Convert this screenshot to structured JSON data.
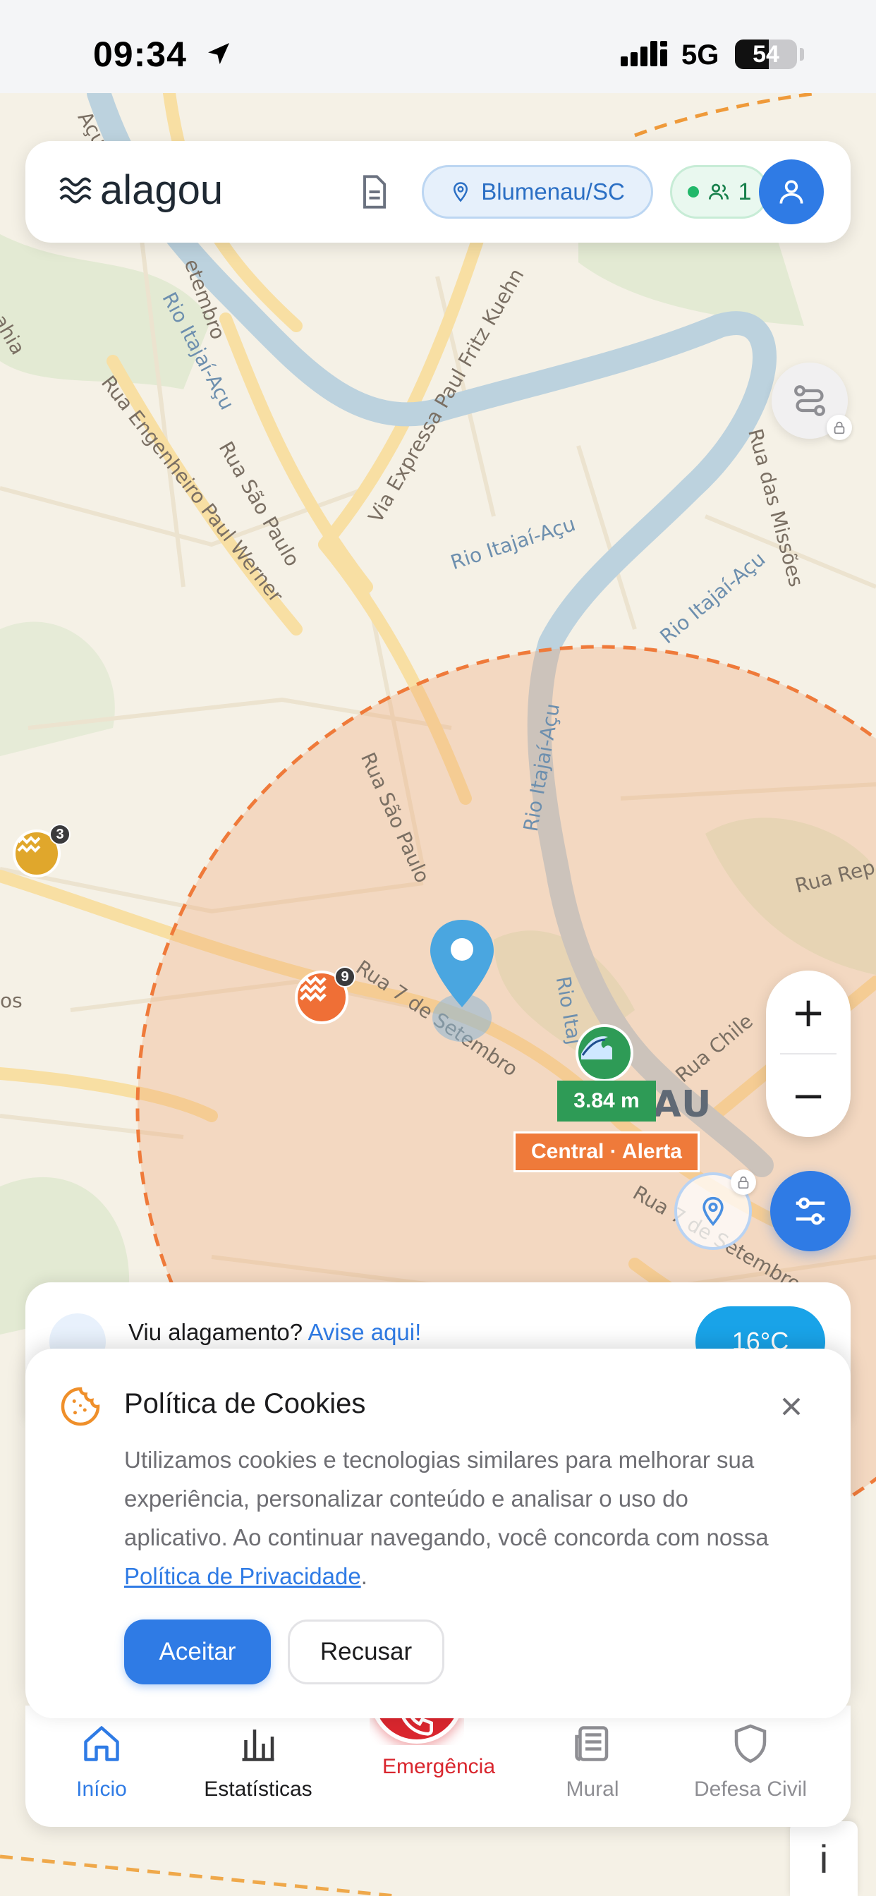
{
  "status_bar": {
    "time": "09:34",
    "network": "5G",
    "battery": "54",
    "battery_level": 0.54
  },
  "header": {
    "logo_text": "alagou",
    "city": "Blumenau/SC",
    "online_count": "1"
  },
  "map": {
    "labels": {
      "rio_itajai_1": "Rio Itajaí-Açu",
      "rio_itajai_2": "Rio Itajaí-Açu",
      "rio_itajai_3": "Rio Itajaí-Açu",
      "rio_itajai_4": "Rio Itajaí-Açu",
      "rio_itajai_5": "Rio Itaj",
      "rio_itajai_6": "Rio Itajaí-Açu",
      "setembro_top": "etembro",
      "eng_paul": "Rua Engenheiro Paul Werner",
      "sao_paulo_top": "Rua São Paulo",
      "via_expressa": "Via Expressa Paul Fritz Kuehn",
      "missoes": "Rua das Missões",
      "sao_paulo_mid": "Rua São Paulo",
      "sete_setembro": "Rua 7 de Setembro",
      "chile": "Rua Chile",
      "rep": "Rua Rep",
      "sete_setembro_2": "Rua 7 de Setembro",
      "city_name": "NAU",
      "os_left": "os",
      "ahia": "ahia",
      "acu_top": "Açu"
    },
    "markers": {
      "flood_left_count": "3",
      "flood_mid_count": "9",
      "sensor_value": "3.84 m",
      "sensor_label": "Central · Alerta"
    },
    "colors": {
      "alert_zone": "#ef7a3a",
      "primary": "#2f7be5",
      "sensor_ok": "#2e9b56"
    }
  },
  "report": {
    "prompt": "Viu alagamento?",
    "link": "Avise aqui!",
    "weather": "16°C"
  },
  "cookie": {
    "title": "Política de Cookies",
    "body": "Utilizamos cookies e tecnologias similares para melhorar sua experiência, personalizar conteúdo e analisar o uso do aplicativo. Ao continuar navegando, você concorda com nossa ",
    "link": "Política de Privacidade",
    "body_end": ".",
    "accept": "Aceitar",
    "reject": "Recusar"
  },
  "bottom_nav": {
    "items": [
      {
        "label": "Início",
        "icon": "home-icon",
        "active": true
      },
      {
        "label": "Estatísticas",
        "icon": "bar-chart-icon"
      },
      {
        "label": "Emergência",
        "icon": "phone-icon"
      },
      {
        "label": "Mural",
        "icon": "newspaper-icon"
      },
      {
        "label": "Defesa Civil",
        "icon": "shield-icon"
      }
    ]
  },
  "info_tab": "i"
}
